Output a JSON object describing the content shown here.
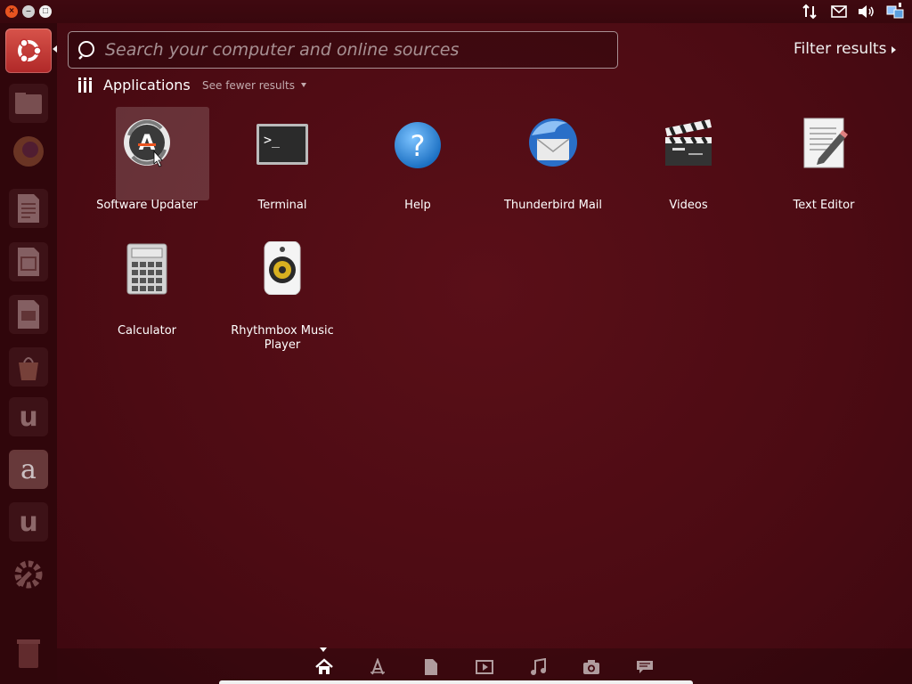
{
  "window_controls": {
    "close": "×",
    "minimize": "–",
    "maximize": "□"
  },
  "tray": {
    "icons": [
      "network-arrows-icon",
      "mail-icon",
      "volume-icon",
      "network-manager-icon"
    ]
  },
  "launcher": {
    "items": [
      "dash-home-icon",
      "files-icon",
      "firefox-icon",
      "writer-icon",
      "calc-icon",
      "impress-icon",
      "software-center-icon",
      "ubuntu-one-icon",
      "amazon-icon",
      "ubuntu-one-music-icon",
      "system-settings-icon",
      "trash-icon"
    ],
    "amazon_glyph": "a",
    "ubuntu_one_glyph": "u"
  },
  "search": {
    "placeholder": "Search your computer and online sources",
    "value": ""
  },
  "filter": {
    "label": "Filter results"
  },
  "category": {
    "title": "Applications",
    "toggle": "See fewer results"
  },
  "apps": [
    {
      "name": "Software Updater",
      "icon": "software-updater-icon",
      "selected": true
    },
    {
      "name": "Terminal",
      "icon": "terminal-icon"
    },
    {
      "name": "Help",
      "icon": "help-icon"
    },
    {
      "name": "Thunderbird Mail",
      "icon": "thunderbird-icon"
    },
    {
      "name": "Videos",
      "icon": "videos-icon"
    },
    {
      "name": "Text Editor",
      "icon": "text-editor-icon"
    },
    {
      "name": "Calculator",
      "icon": "calculator-icon"
    },
    {
      "name": "Rhythmbox Music Player",
      "icon": "rhythmbox-icon"
    }
  ],
  "icon_glyphs": {
    "terminal": ">_",
    "help": "?",
    "updater": "A"
  },
  "lenses": [
    "home-lens-icon",
    "applications-lens-icon",
    "files-lens-icon",
    "video-lens-icon",
    "music-lens-icon",
    "photo-lens-icon",
    "social-lens-icon"
  ],
  "colors": {
    "background": "#4a0b12",
    "accent": "#e95420",
    "text": "#ffffff"
  }
}
